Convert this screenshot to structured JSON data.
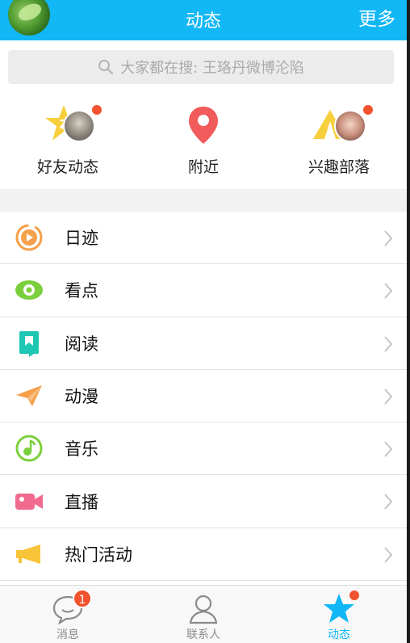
{
  "header": {
    "title": "动态",
    "more_label": "更多",
    "accent": "#12b7f5"
  },
  "search": {
    "placeholder": "大家都在搜: 王珞丹微博沦陷"
  },
  "quick": [
    {
      "label": "好友动态",
      "icon": "star-z-icon",
      "has_dot": true
    },
    {
      "label": "附近",
      "icon": "location-pin-icon",
      "has_dot": false
    },
    {
      "label": "兴趣部落",
      "icon": "tent-icon",
      "has_dot": true
    }
  ],
  "list": [
    {
      "label": "日迹",
      "icon": "play-circle-icon",
      "color": "#f5a04a"
    },
    {
      "label": "看点",
      "icon": "eye-icon",
      "color": "#7ccf3c"
    },
    {
      "label": "阅读",
      "icon": "bookmark-icon",
      "color": "#1ec7b3"
    },
    {
      "label": "动漫",
      "icon": "paper-plane-icon",
      "color": "#f5a04a"
    },
    {
      "label": "音乐",
      "icon": "music-note-icon",
      "color": "#7ccf3c"
    },
    {
      "label": "直播",
      "icon": "video-camera-icon",
      "color": "#f06b8f"
    },
    {
      "label": "热门活动",
      "icon": "megaphone-icon",
      "color": "#f7c43a"
    }
  ],
  "tabs": [
    {
      "label": "消息",
      "icon": "chat-bubble-icon",
      "badge": "1",
      "active": false
    },
    {
      "label": "联系人",
      "icon": "person-icon",
      "active": false
    },
    {
      "label": "动态",
      "icon": "star-icon",
      "active": true,
      "has_dot": true
    }
  ],
  "colors": {
    "badge_red": "#f2522e",
    "tab_active": "#12b7f5",
    "tab_inactive": "#8a8a8a"
  }
}
